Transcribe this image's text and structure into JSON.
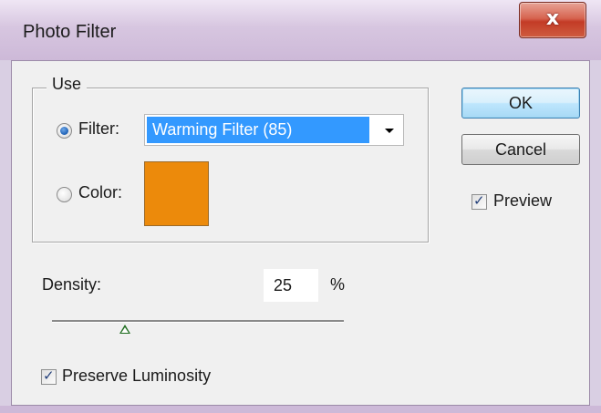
{
  "window": {
    "title": "Photo Filter",
    "close_glyph": "x"
  },
  "use_group": {
    "legend": "Use",
    "filter_label": "Filter:",
    "filter_selected": true,
    "filter_value": "Warming Filter (85)",
    "color_label": "Color:",
    "color_selected": false,
    "color_value": "#ec8a0b"
  },
  "buttons": {
    "ok": "OK",
    "cancel": "Cancel"
  },
  "preview": {
    "label": "Preview",
    "checked": true
  },
  "density": {
    "label": "Density:",
    "value": "25",
    "unit": "%",
    "slider_fraction": 0.25
  },
  "preserve_luminosity": {
    "label": "Preserve Luminosity",
    "checked": true
  },
  "icons": {
    "check": "✓",
    "dropdown": "chevron-down-icon",
    "radio": "radio-button-icon",
    "slider_thumb": "triangle-up-icon"
  },
  "colors": {
    "selection_highlight": "#3399ff",
    "titlebar": "#d7c6e0",
    "close_button": "#c33b26",
    "dialog_face": "#f0f0f0"
  }
}
